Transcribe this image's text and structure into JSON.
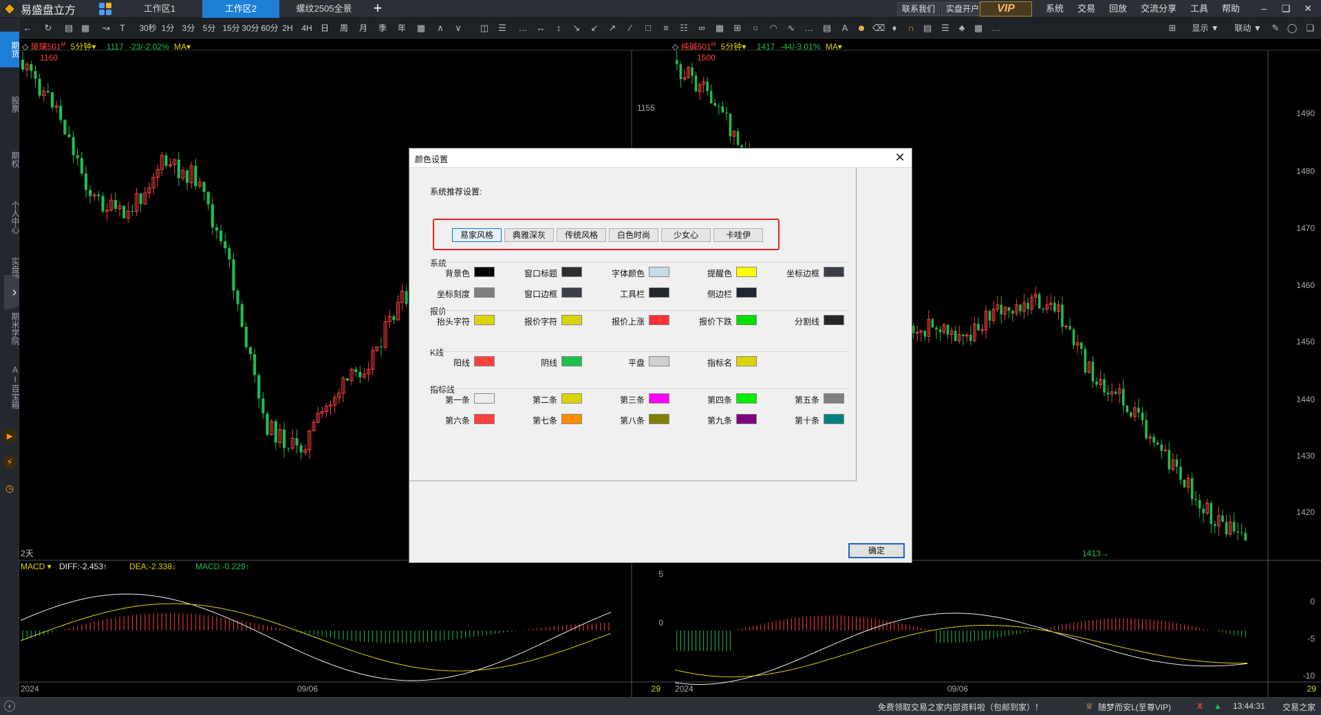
{
  "app": {
    "name": "易盛盘立方",
    "workspace_tabs": [
      {
        "label": "工作区1",
        "active": false
      },
      {
        "label": "工作区2",
        "active": true
      },
      {
        "label": "螺纹2505全景",
        "active": false
      }
    ],
    "add_tab": "+",
    "contact": "联系我们",
    "open_account": "实盘开户",
    "vip": "VIP",
    "menus": [
      "系统",
      "交易",
      "回放",
      "交流分享",
      "工具",
      "帮助"
    ]
  },
  "toolbar": {
    "periods": [
      "30秒",
      "1分",
      "3分",
      "5分",
      "15分",
      "30分",
      "60分",
      "2H",
      "4H",
      "日",
      "周",
      "月",
      "季",
      "年"
    ],
    "display": "显示",
    "link": "联动"
  },
  "sidenav": {
    "items": [
      "期货",
      "股票",
      "期权",
      "个人中心",
      "实盘榜单",
      "期米学院",
      "AI百宝箱"
    ],
    "active": "期货"
  },
  "chart_left": {
    "symbol": "玻璃501",
    "badge": "M",
    "period": "5分钟",
    "price": "1117",
    "change": "-23/-2.02%",
    "indicator": "MA",
    "high_label": "1160",
    "range_label": "2天",
    "macd": {
      "name": "MACD",
      "diff": "DIFF:-2.453↑",
      "dea": "DEA:-2.338↓",
      "macd": "MACD:-0.229↑"
    },
    "macd_axis": [
      "5",
      "0"
    ],
    "left_axis_label": "1155",
    "date_labels": [
      "2024",
      "09/06"
    ],
    "count": "29"
  },
  "chart_right": {
    "symbol": "纯碱501",
    "badge": "M",
    "period": "5分钟",
    "price": "1417",
    "change": "-44/-3.01%",
    "indicator": "MA",
    "high_label": "1500",
    "low_label": "1413",
    "y_ticks": [
      "1490",
      "1480",
      "1470",
      "1460",
      "1450",
      "1440",
      "1430",
      "1420"
    ],
    "macd_axis": [
      "0",
      "-5",
      "-10"
    ],
    "date_labels": [
      "2024",
      "09/06"
    ],
    "count": "29"
  },
  "dialog": {
    "title": "颜色设置",
    "preset_label": "系统推荐设置:",
    "presets": [
      "易家风格",
      "典雅深灰",
      "传统风格",
      "白色时尚",
      "少女心",
      "卡哇伊"
    ],
    "groups": [
      {
        "title": "系统",
        "items": [
          {
            "label": "背景色",
            "color": "#000000"
          },
          {
            "label": "窗口标题",
            "color": "#2e2e2e"
          },
          {
            "label": "字体颜色",
            "color": "#c8dce8"
          },
          {
            "label": "提醒色",
            "color": "#ffff00"
          },
          {
            "label": "坐标边框",
            "color": "#3a3f47"
          },
          {
            "label": "坐标刻度",
            "color": "#7f7f7f"
          },
          {
            "label": "窗口边框",
            "color": "#3c4048"
          },
          {
            "label": "工具栏",
            "color": "#24272c"
          },
          {
            "label": "侧边栏",
            "color": "#1f2533"
          }
        ]
      },
      {
        "title": "报价",
        "items": [
          {
            "label": "抬头字符",
            "color": "#dcd400"
          },
          {
            "label": "报价字符",
            "color": "#dcd400"
          },
          {
            "label": "报价上涨",
            "color": "#ff3333"
          },
          {
            "label": "报价下跌",
            "color": "#00dd00"
          },
          {
            "label": "分割线",
            "color": "#22252a"
          }
        ]
      },
      {
        "title": "K线",
        "items": [
          {
            "label": "阳线",
            "color": "#ff4040"
          },
          {
            "label": "阴线",
            "color": "#1fbf50"
          },
          {
            "label": "平盘",
            "color": "#d0d0d0"
          },
          {
            "label": "指标名",
            "color": "#dcd400"
          }
        ]
      },
      {
        "title": "指标线",
        "items": [
          {
            "label": "第一条",
            "color": "#eeeeee"
          },
          {
            "label": "第二条",
            "color": "#dcd400"
          },
          {
            "label": "第三条",
            "color": "#ff00ff"
          },
          {
            "label": "第四条",
            "color": "#00ee00"
          },
          {
            "label": "第五条",
            "color": "#808080"
          },
          {
            "label": "第六条",
            "color": "#ff4040"
          },
          {
            "label": "第七条",
            "color": "#ff8c00"
          },
          {
            "label": "第八条",
            "color": "#808000"
          },
          {
            "label": "第九条",
            "color": "#800080"
          },
          {
            "label": "第十条",
            "color": "#008080"
          }
        ]
      }
    ],
    "ok": "确定"
  },
  "statusbar": {
    "promo": "免费领取交易之家内部资料啦（包邮到家）！",
    "user": "随梦而安L(至尊VIP)",
    "time": "13:44:31",
    "brand": "交易之家"
  },
  "colors": {
    "up": "#ff4040",
    "down": "#1fbf50",
    "accent": "#1e7fd6",
    "yellow": "#dcd400"
  }
}
